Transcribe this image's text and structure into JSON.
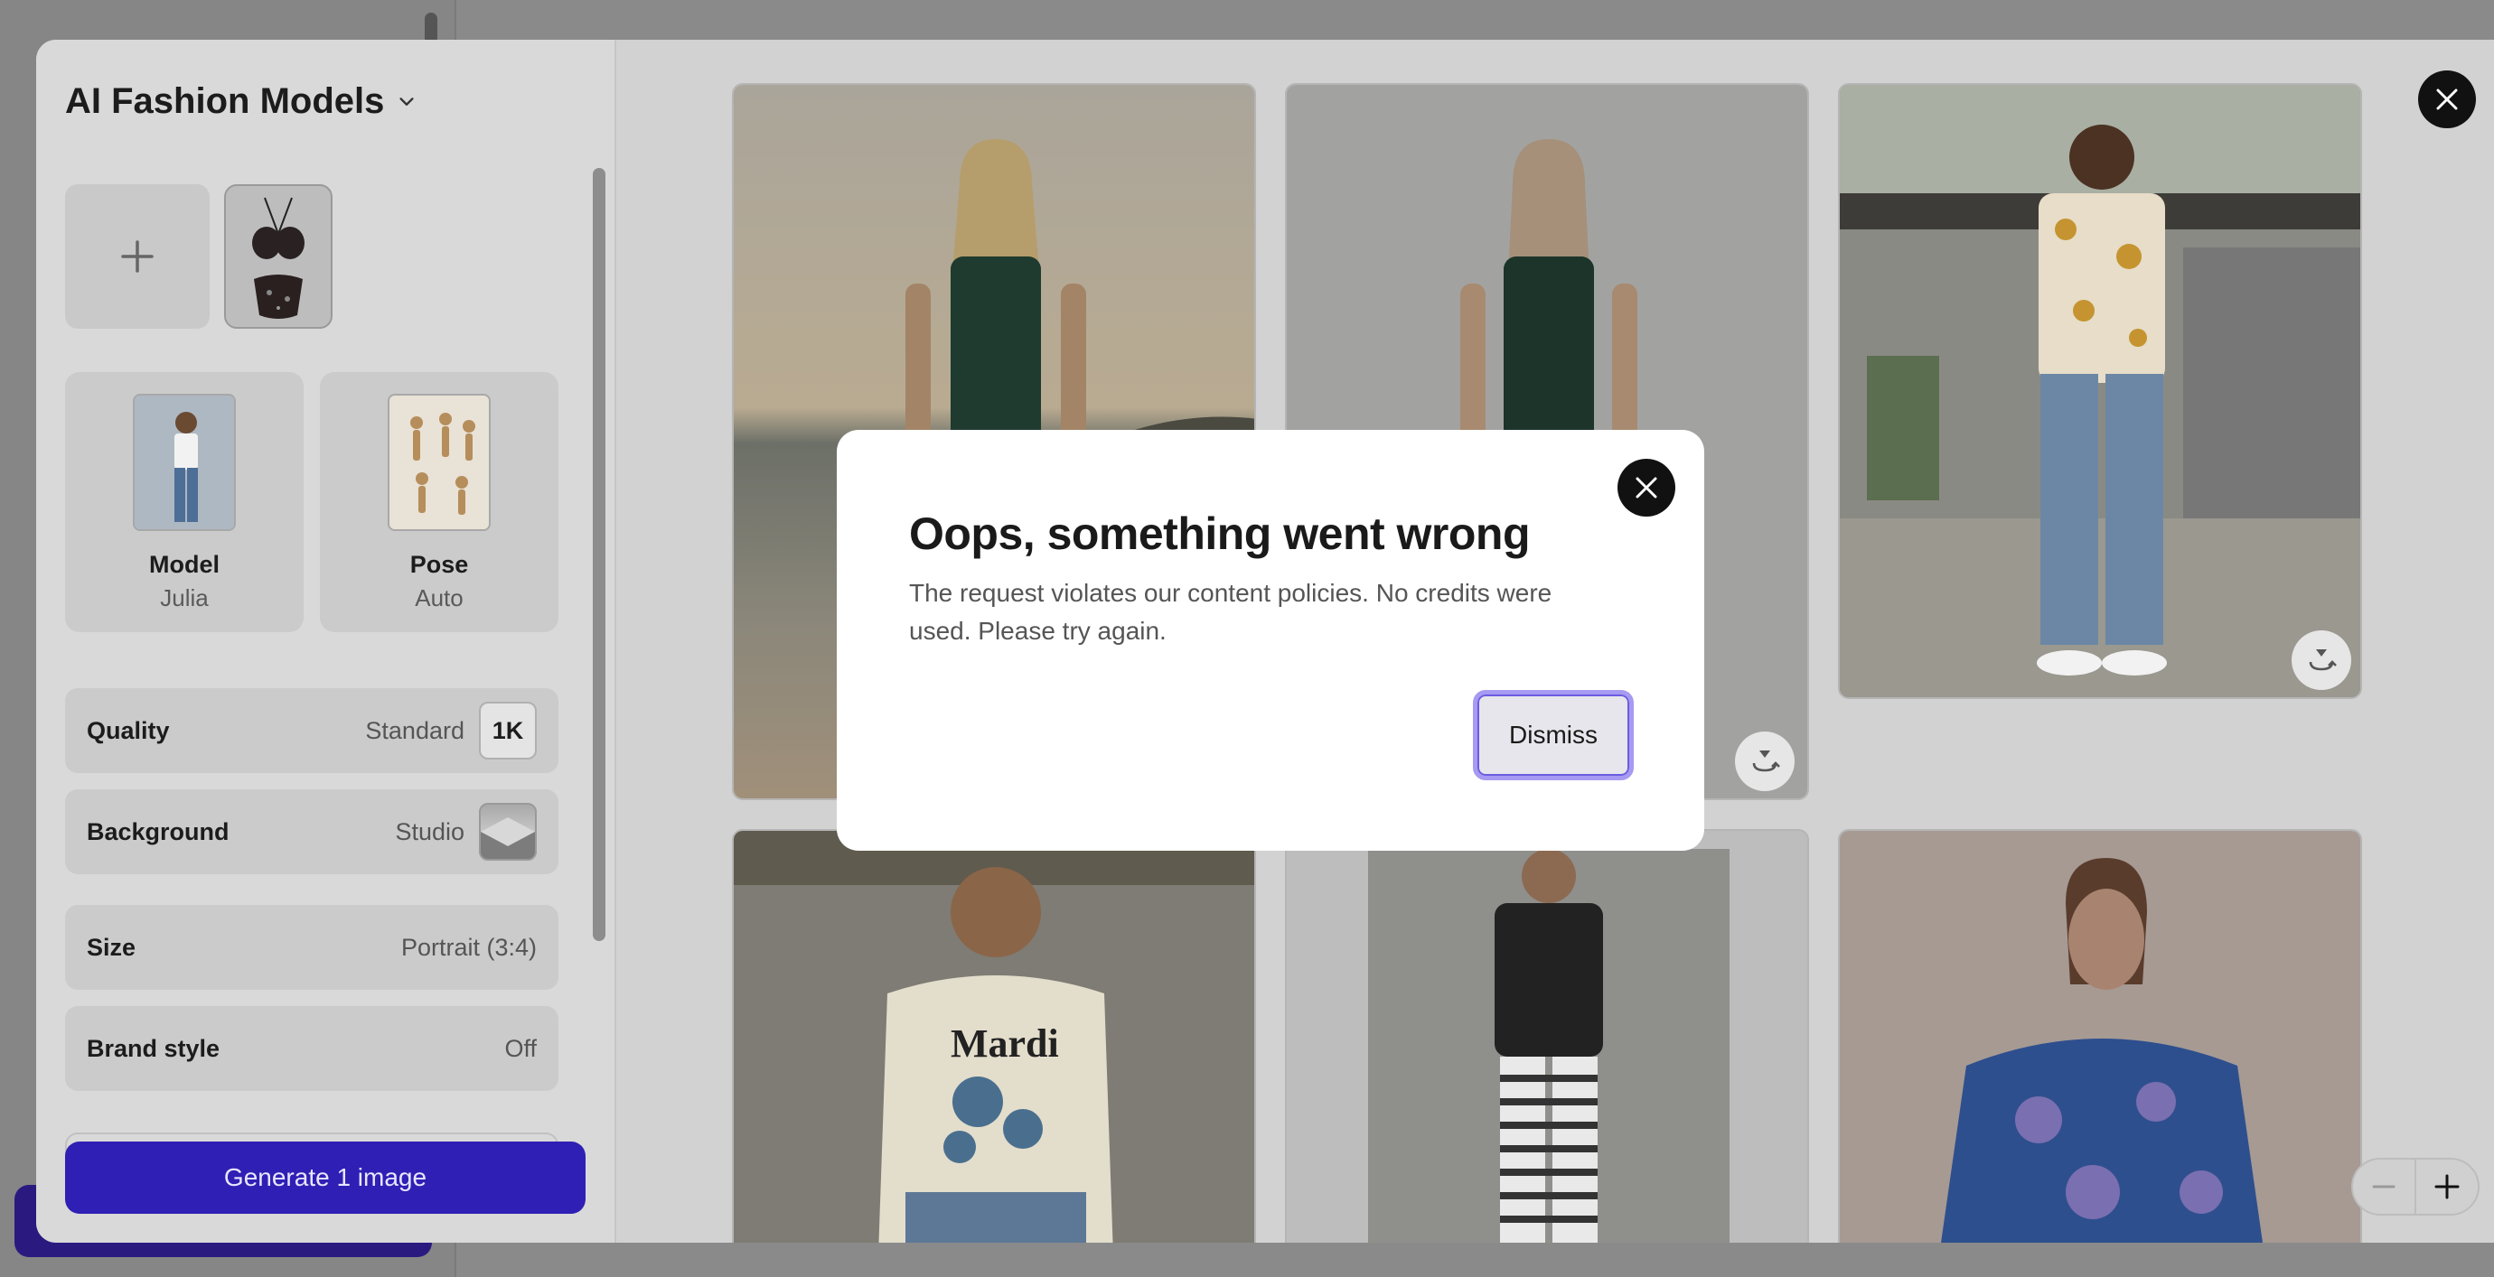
{
  "panel": {
    "title": "AI Fashion Models",
    "model": {
      "label": "Model",
      "value": "Julia"
    },
    "pose": {
      "label": "Pose",
      "value": "Auto"
    },
    "quality": {
      "label": "Quality",
      "value": "Standard",
      "badge": "1K"
    },
    "background": {
      "label": "Background",
      "value": "Studio"
    },
    "size": {
      "label": "Size",
      "value": "Portrait (3:4)"
    },
    "brand_style": {
      "label": "Brand style",
      "value": "Off"
    },
    "generate_label": "Generate 1 image"
  },
  "modal": {
    "title": "Oops, something went wrong",
    "message": "The request violates our content policies. No credits were used. Please try again.",
    "dismiss_label": "Dismiss"
  },
  "gallery": {
    "shirt_text": "Mardi"
  },
  "colors": {
    "accent": "#2f1fb4",
    "dismiss_focus": "#a69af2"
  }
}
